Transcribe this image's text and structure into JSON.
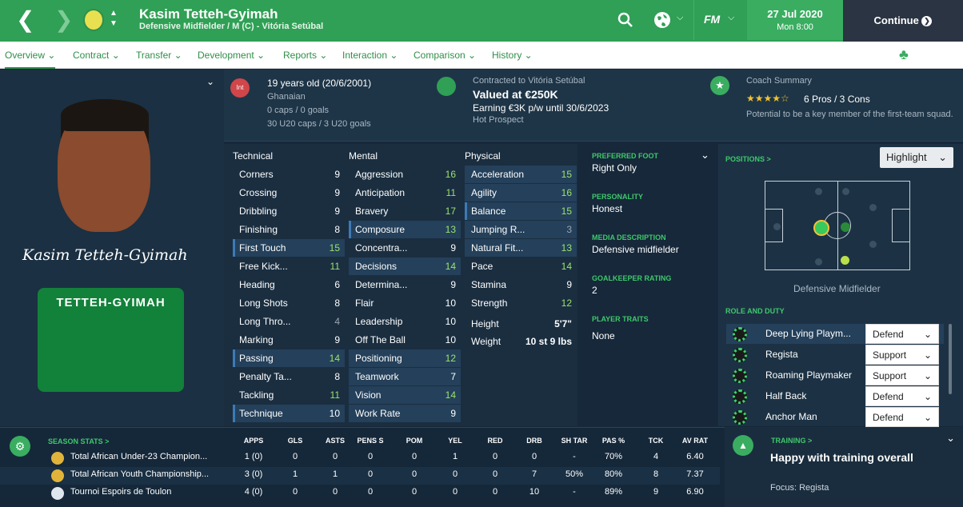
{
  "header": {
    "name": "Kasim Tetteh-Gyimah",
    "subtitle": "Defensive Midfielder / M (C) - Vitória Setúbal",
    "fm_label": "FM",
    "date": "27 Jul 2020",
    "day_time": "Mon 8:00",
    "continue": "Continue"
  },
  "tabs": [
    "Overview",
    "Development",
    "Reports",
    "Interaction",
    "Comparison",
    "History",
    "Contract",
    "Transfer"
  ],
  "info": {
    "age": "19 years old (20/6/2001)",
    "nation": "Ghanaian",
    "caps": "0 caps / 0 goals",
    "u20": "30 U20 caps / 3 U20 goals",
    "intl": "Int",
    "contract": "Contracted to Vitória Setúbal",
    "value": "Valued at €250K",
    "wage": "Earning €3K p/w until 30/6/2023",
    "prospect": "Hot Prospect",
    "coach_title": "Coach Summary",
    "stars": "★★★★☆",
    "proscons": "6 Pros / 3 Cons",
    "potential": "Potential to be a key member of the first-team squad."
  },
  "player": {
    "signature": "Kasim Tetteh-Gyimah",
    "shirt": "TETTEH-GYIMAH"
  },
  "attr_heads": {
    "technical": "Technical",
    "mental": "Mental",
    "physical": "Physical"
  },
  "technical": [
    [
      "Corners",
      "9"
    ],
    [
      "Crossing",
      "9"
    ],
    [
      "Dribbling",
      "9"
    ],
    [
      "Finishing",
      "8"
    ],
    [
      "First Touch",
      "15"
    ],
    [
      "Free Kick...",
      "11"
    ],
    [
      "Heading",
      "6"
    ],
    [
      "Long Shots",
      "8"
    ],
    [
      "Long Thro...",
      "4"
    ],
    [
      "Marking",
      "9"
    ],
    [
      "Passing",
      "14"
    ],
    [
      "Penalty Ta...",
      "8"
    ],
    [
      "Tackling",
      "11"
    ],
    [
      "Technique",
      "10"
    ]
  ],
  "mental": [
    [
      "Aggression",
      "16"
    ],
    [
      "Anticipation",
      "11"
    ],
    [
      "Bravery",
      "17"
    ],
    [
      "Composure",
      "13"
    ],
    [
      "Concentra...",
      "9"
    ],
    [
      "Decisions",
      "14"
    ],
    [
      "Determina...",
      "9"
    ],
    [
      "Flair",
      "10"
    ],
    [
      "Leadership",
      "10"
    ],
    [
      "Off The Ball",
      "10"
    ],
    [
      "Positioning",
      "12"
    ],
    [
      "Teamwork",
      "7"
    ],
    [
      "Vision",
      "14"
    ],
    [
      "Work Rate",
      "9"
    ]
  ],
  "physical": [
    [
      "Acceleration",
      "15"
    ],
    [
      "Agility",
      "16"
    ],
    [
      "Balance",
      "15"
    ],
    [
      "Jumping R...",
      "3"
    ],
    [
      "Natural Fit...",
      "13"
    ],
    [
      "Pace",
      "14"
    ],
    [
      "Stamina",
      "9"
    ],
    [
      "Strength",
      "12"
    ]
  ],
  "height": {
    "label": "Height",
    "value": "5'7\""
  },
  "weight": {
    "label": "Weight",
    "value": "10 st 9 lbs"
  },
  "side": {
    "foot_l": "PREFERRED FOOT",
    "foot": "Right Only",
    "pers_l": "PERSONALITY",
    "pers": "Honest",
    "media_l": "MEDIA DESCRIPTION",
    "media": "Defensive midfielder",
    "gk_l": "GOALKEEPER RATING",
    "gk": "2",
    "traits_l": "PLAYER TRAITS",
    "traits": "None"
  },
  "positions": {
    "label": "POSITIONS >",
    "highlight": "Highlight",
    "pos_name": "Defensive Midfielder",
    "role_label": "ROLE AND DUTY"
  },
  "roles": [
    [
      "Deep Lying Playm...",
      "Defend"
    ],
    [
      "Regista",
      "Support"
    ],
    [
      "Roaming Playmaker",
      "Support"
    ],
    [
      "Half Back",
      "Defend"
    ],
    [
      "Anchor Man",
      "Defend"
    ]
  ],
  "season": {
    "label": "SEASON STATS >",
    "cols": [
      "APPS",
      "GLS",
      "ASTS",
      "PENS S",
      "POM",
      "YEL",
      "RED",
      "DRB",
      "SH TAR",
      "PAS %",
      "TCK",
      "AV RAT"
    ],
    "rows": [
      [
        "Total African Under-23 Champion...",
        "1 (0)",
        "0",
        "0",
        "0",
        "0",
        "1",
        "0",
        "0",
        "-",
        "70%",
        "4",
        "6.40"
      ],
      [
        "Total African Youth Championship...",
        "3 (0)",
        "1",
        "1",
        "0",
        "0",
        "0",
        "0",
        "7",
        "50%",
        "80%",
        "8",
        "7.37"
      ],
      [
        "Tournoi Espoirs de Toulon",
        "4 (0)",
        "0",
        "0",
        "0",
        "0",
        "0",
        "0",
        "10",
        "-",
        "89%",
        "9",
        "6.90"
      ]
    ]
  },
  "training": {
    "label": "TRAINING >",
    "status": "Happy with training overall",
    "focus": "Focus:  Regista"
  },
  "colors": {
    "header_green": "#2fa055",
    "accent_green": "#3fc86b",
    "attr_green": "#9be36e"
  }
}
